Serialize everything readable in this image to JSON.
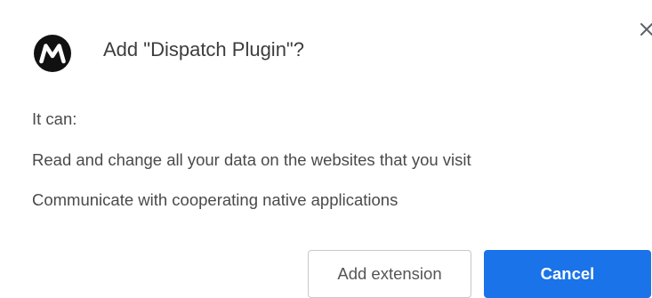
{
  "dialog": {
    "title": "Add \"Dispatch Plugin\"?",
    "permissions_heading": "It can:",
    "permissions": [
      "Read and change all your data on the websites that you visit",
      "Communicate with cooperating native applications"
    ],
    "close_icon": "close-icon",
    "logo_icon": "motorola-logo"
  },
  "buttons": {
    "add_extension": "Add extension",
    "cancel": "Cancel"
  },
  "colors": {
    "primary": "#1a73e8",
    "text": "#444444"
  }
}
